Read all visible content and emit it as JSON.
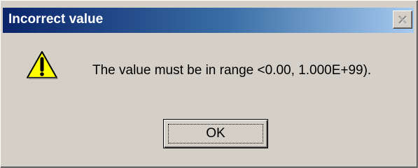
{
  "dialog": {
    "title": "Incorrect value",
    "message": "The value must be in range <0.00, 1.000E+99).",
    "ok_label": "OK",
    "icons": {
      "close": "close-icon",
      "warning": "warning-icon"
    },
    "colors": {
      "titlebar_start": "#0a246a",
      "titlebar_end": "#a6caf0",
      "face": "#d4d0c8",
      "warning_fill": "#ffff00"
    }
  }
}
